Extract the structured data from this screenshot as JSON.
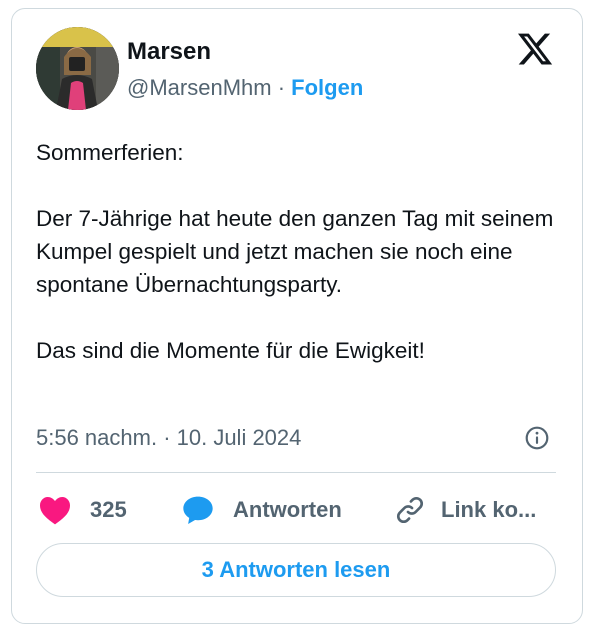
{
  "author": {
    "name": "Marsen",
    "handle": "@MarsenMhm",
    "separator": "·",
    "follow_label": "Folgen"
  },
  "tweet": {
    "text": "Sommerferien:\n\nDer 7-Jährige hat heute den ganzen Tag mit seinem Kumpel gespielt und jetzt machen sie noch eine spontane Übernachtungsparty.\n\nDas sind die Momente für die Ewigkeit!",
    "timestamp": "5:56 nachm. · 10. Juli 2024"
  },
  "actions": {
    "like_count": "325",
    "reply_label": "Antworten",
    "link_label": "Link ko..."
  },
  "read_replies_label": "3 Antworten lesen",
  "colors": {
    "accent": "#1d9bf0",
    "like": "#f91880",
    "muted": "#536471",
    "border": "#cfd9de"
  },
  "icons": [
    "x-logo-icon",
    "info-icon",
    "heart-icon",
    "reply-bubble-icon",
    "link-icon"
  ]
}
